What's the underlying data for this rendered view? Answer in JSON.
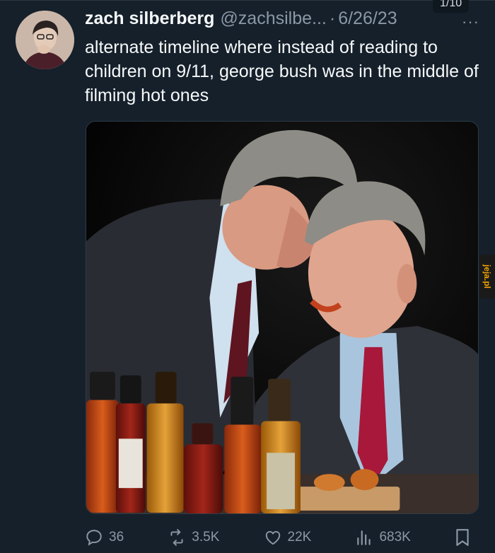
{
  "image_counter": "1/10",
  "tweet": {
    "author_name": "zach silberberg",
    "handle": "@zachsilbe...",
    "separator": "·",
    "date": "6/26/23",
    "more_label": "···",
    "text": "alternate timeline where instead of reading to children on 9/11, george bush was in the middle of filming hot ones"
  },
  "watermark": "jeja.pl",
  "actions": {
    "replies": "36",
    "reposts": "3.5K",
    "likes": "22K",
    "views": "683K"
  },
  "icons": {
    "reply": "speech-bubble-icon",
    "repost": "retweet-icon",
    "like": "heart-icon",
    "views": "bar-chart-icon",
    "bookmark": "bookmark-icon"
  },
  "colors": {
    "background": "#15202b",
    "text": "#f7f9f9",
    "muted": "#8b98a5",
    "watermark": "#f2a300"
  }
}
